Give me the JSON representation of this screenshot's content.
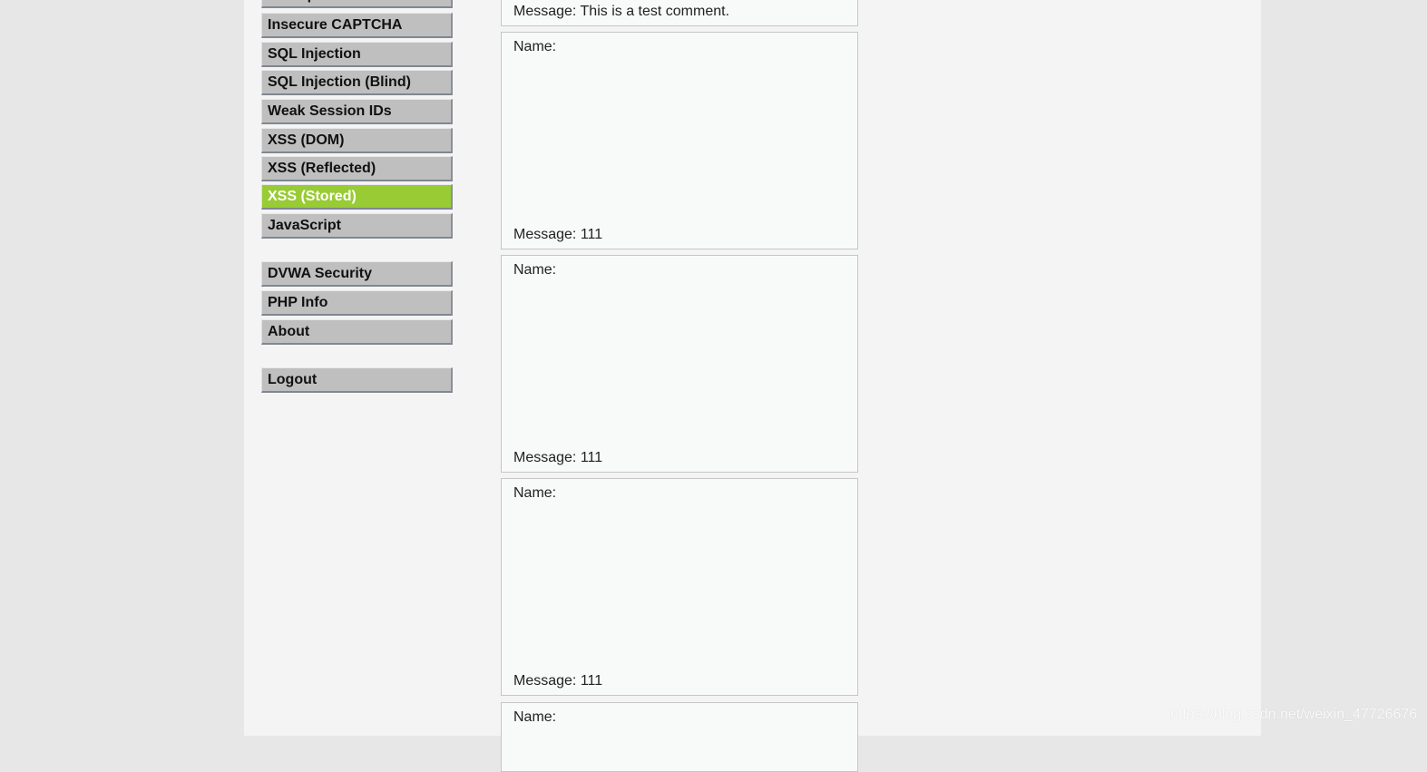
{
  "menu": {
    "group1": [
      "File Upload",
      "Insecure CAPTCHA",
      "SQL Injection",
      "SQL Injection (Blind)",
      "Weak Session IDs",
      "XSS (DOM)",
      "XSS (Reflected)",
      "XSS (Stored)",
      "JavaScript"
    ],
    "group2": [
      "DVWA Security",
      "PHP Info",
      "About"
    ],
    "group3": [
      "Logout"
    ],
    "selected": "XSS (Stored)",
    "selected_color": "#98cb34"
  },
  "comments": [
    {
      "name": "Name:",
      "message": "Message: This is a test comment."
    },
    {
      "name": "Name:",
      "message": "Message: 111"
    },
    {
      "name": "Name:",
      "message": "Message: 111"
    },
    {
      "name": "Name:",
      "message": "Message: 111"
    },
    {
      "name": "Name:",
      "message": ""
    }
  ],
  "watermark": "https://blog.csdn.net/weixin_47726676"
}
